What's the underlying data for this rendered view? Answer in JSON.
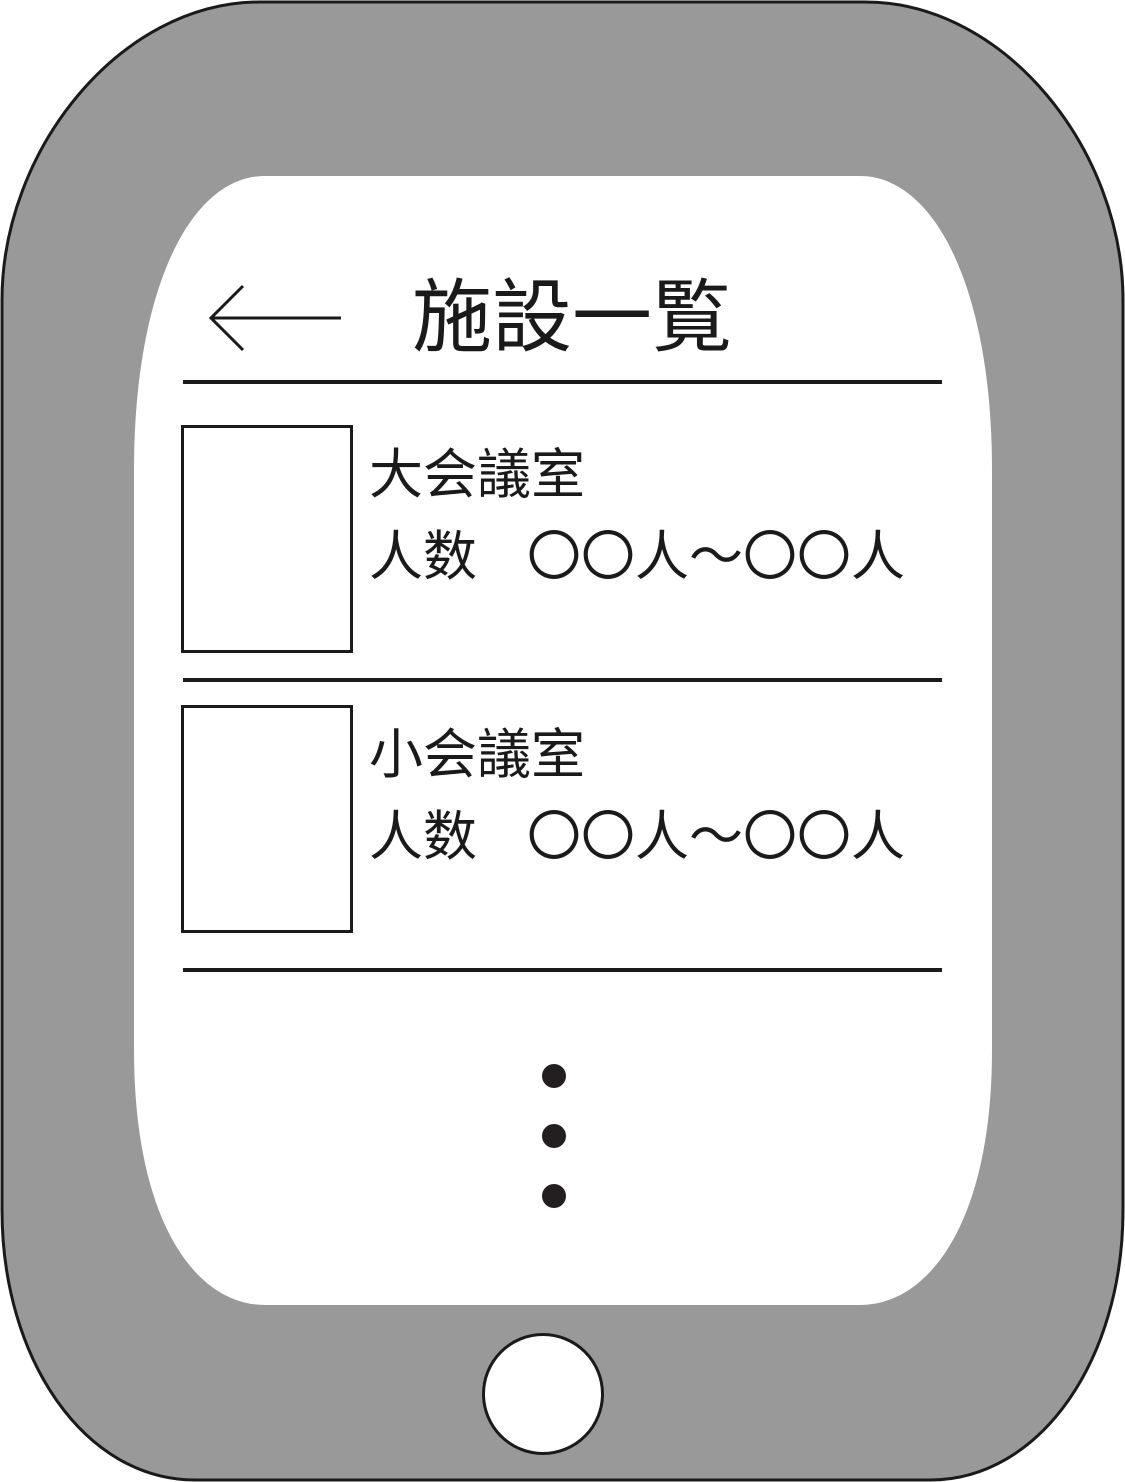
{
  "colors": {
    "bezel": "#999999",
    "screen": "#ffffff",
    "ink": "#1a1a1a"
  },
  "header": {
    "back_icon": "arrow-left-icon",
    "title": "施設一覧"
  },
  "facilities": [
    {
      "name": "大会議室",
      "capacity_label": "人数",
      "capacity_value": "〇〇人～〇〇人"
    },
    {
      "name": "小会議室",
      "capacity_label": "人数",
      "capacity_value": "〇〇人～〇〇人"
    }
  ],
  "more_indicator_icon": "vertical-ellipsis-icon",
  "home_button_icon": "home-button-icon"
}
